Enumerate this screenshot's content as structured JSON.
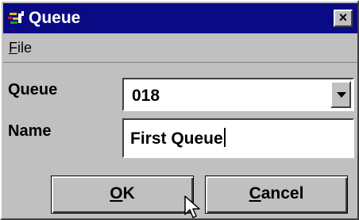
{
  "window": {
    "title": "Queue",
    "close_label": "×"
  },
  "menu": {
    "file_mnemonic": "F",
    "file_rest": "ile"
  },
  "form": {
    "queue_label": "Queue",
    "queue_value": "018",
    "name_label": "Name",
    "name_value": "First Queue"
  },
  "buttons": {
    "ok_mnemonic": "O",
    "ok_rest": "K",
    "cancel_mnemonic": "C",
    "cancel_rest": "ancel"
  },
  "icons": {
    "title": "queue-app-icon",
    "close": "close-icon",
    "dropdown": "dropdown-arrow-icon",
    "cursor": "mouse-pointer-icon"
  },
  "colors": {
    "titlebar": "#0a0a84",
    "face": "#c0c0c0"
  }
}
